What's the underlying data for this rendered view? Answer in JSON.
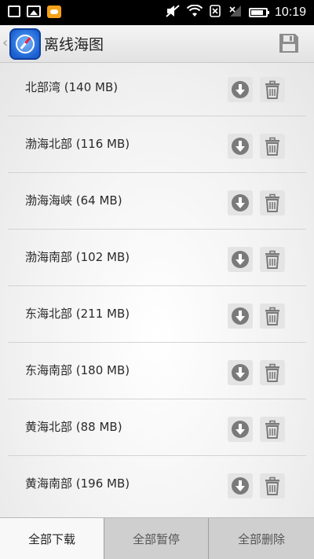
{
  "status_bar": {
    "time": "10:19",
    "icons": [
      "message-icon",
      "image-icon",
      "game-icon",
      "mute-icon",
      "wifi-icon",
      "no-sim-icon",
      "signal-icon",
      "battery-icon"
    ]
  },
  "header": {
    "title": "离线海图",
    "back_glyph": "‹",
    "save_icon": "save-icon"
  },
  "regions": [
    {
      "label": "北部湾 (140 MB)"
    },
    {
      "label": "渤海北部 (116 MB)"
    },
    {
      "label": "渤海海峡 (64 MB)"
    },
    {
      "label": "渤海南部 (102 MB)"
    },
    {
      "label": "东海北部 (211 MB)"
    },
    {
      "label": "东海南部 (180 MB)"
    },
    {
      "label": "黄海北部 (88 MB)"
    },
    {
      "label": "黄海南部 (196 MB)"
    }
  ],
  "bottom_bar": {
    "download_all": "全部下载",
    "pause_all": "全部暂停",
    "delete_all": "全部删除"
  },
  "colors": {
    "accent_icon": "#7a7a7a",
    "status_bar_bg": "#000000",
    "app_logo_blue": "#1b5fd0"
  }
}
